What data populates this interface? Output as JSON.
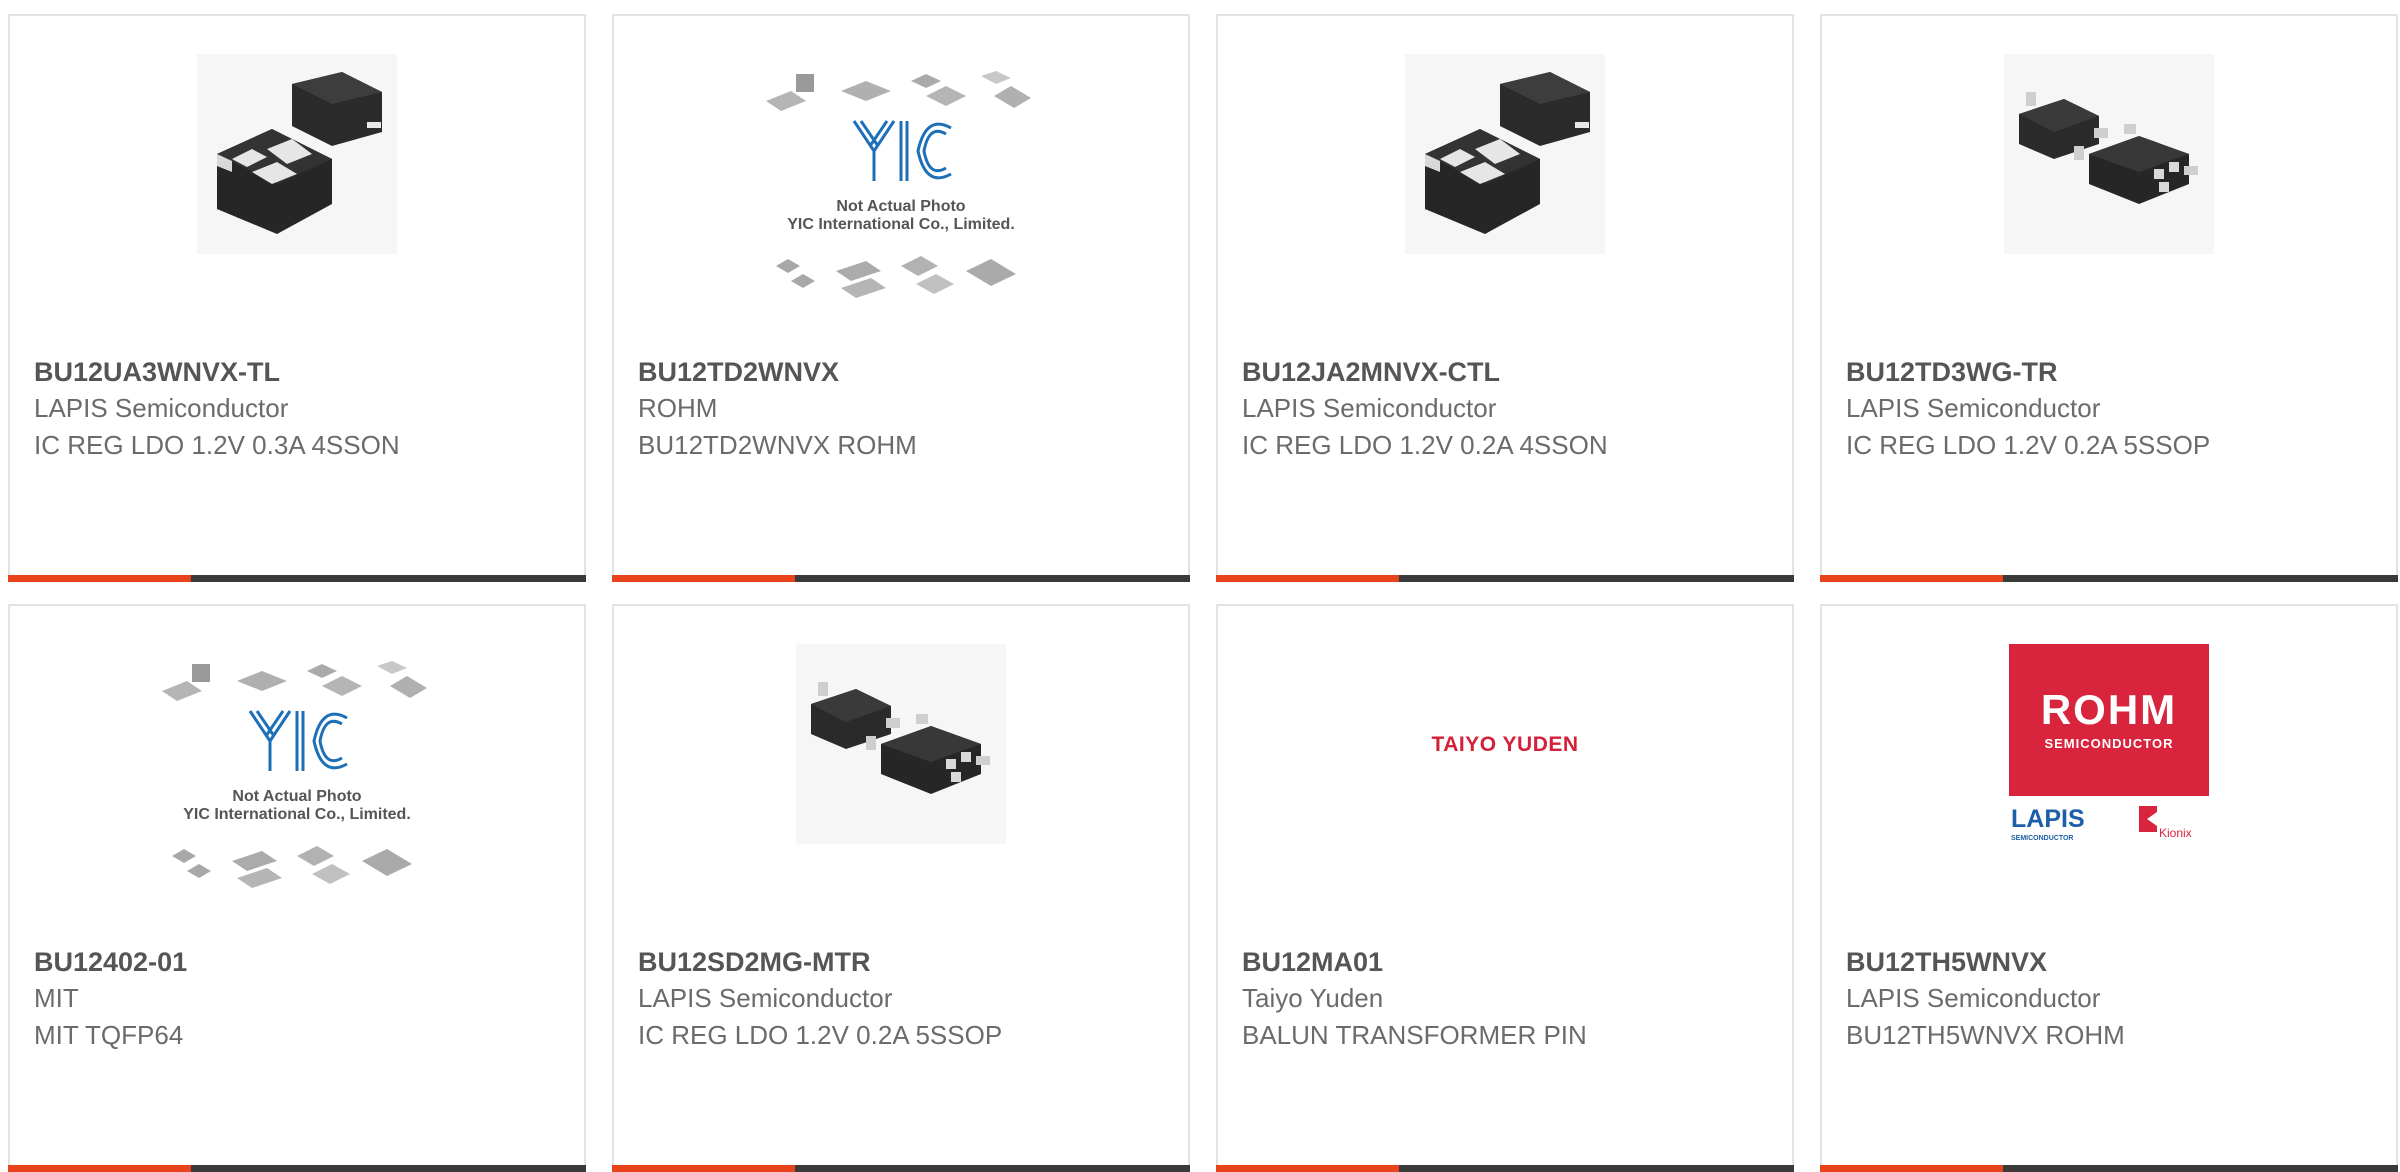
{
  "theme": {
    "accent_color": "#e8431b",
    "bar_color": "#3a3a3a"
  },
  "placeholder_image": {
    "line1": "Not Actual Photo",
    "line2": "YIC International Co., Limited.",
    "logo_text": "YIC"
  },
  "products": [
    {
      "part_number": "BU12UA3WNVX-TL",
      "manufacturer": "LAPIS Semiconductor",
      "description": "IC REG LDO 1.2V 0.3A 4SSON",
      "image": "son-package-photo"
    },
    {
      "part_number": "BU12TD2WNVX",
      "manufacturer": "ROHM",
      "description": "BU12TD2WNVX ROHM",
      "image": "yic-placeholder"
    },
    {
      "part_number": "BU12JA2MNVX-CTL",
      "manufacturer": "LAPIS Semiconductor",
      "description": "IC REG LDO 1.2V 0.2A 4SSON",
      "image": "son-package-photo"
    },
    {
      "part_number": "BU12TD3WG-TR",
      "manufacturer": "LAPIS Semiconductor",
      "description": "IC REG LDO 1.2V 0.2A 5SSOP",
      "image": "ssop-package-photo"
    },
    {
      "part_number": "BU12402-01",
      "manufacturer": "MIT",
      "description": "MIT TQFP64",
      "image": "yic-placeholder"
    },
    {
      "part_number": "BU12SD2MG-MTR",
      "manufacturer": "LAPIS Semiconductor",
      "description": "IC REG LDO 1.2V 0.2A 5SSOP",
      "image": "ssop-package-photo"
    },
    {
      "part_number": "BU12MA01",
      "manufacturer": "Taiyo Yuden",
      "description": "BALUN TRANSFORMER PIN",
      "image": "taiyo-yuden-logo",
      "logo_text": "TAIYO YUDEN"
    },
    {
      "part_number": "BU12TH5WNVX",
      "manufacturer": "LAPIS Semiconductor",
      "description": "BU12TH5WNVX ROHM",
      "image": "rohm-lapis-logo",
      "logo_text": {
        "rohm": "ROHM",
        "rohm_sub": "SEMICONDUCTOR",
        "lapis": "LAPIS",
        "lapis_sub": "SEMICONDUCTOR",
        "kionix": "Kionix"
      }
    }
  ]
}
